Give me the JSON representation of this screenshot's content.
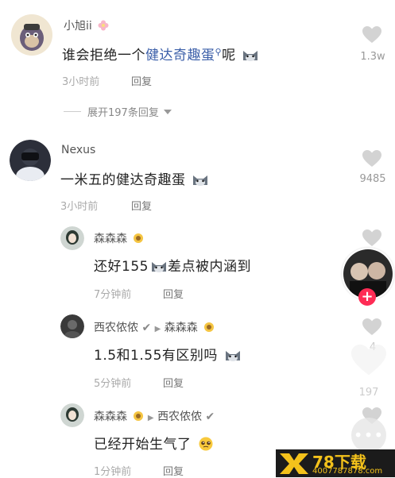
{
  "comments": [
    {
      "user": "小旭ii",
      "text_before": "谁会拒绝一个",
      "text_link": "健达奇趣蛋",
      "text_after": "呢",
      "time": "3小时前",
      "reply_label": "回复",
      "likes": "1.3w",
      "expand_label": "展开197条回复"
    },
    {
      "user": "Nexus",
      "text": "一米五的健达奇趣蛋",
      "time": "3小时前",
      "reply_label": "回复",
      "likes": "9485"
    }
  ],
  "replies": [
    {
      "user": "森森森",
      "text": "还好155",
      "text_after": "差点被内涵到",
      "time": "7分钟前",
      "reply_label": "回复"
    },
    {
      "user": "西农侬侬",
      "reply_to": "森森森",
      "text": "1.5和1.55有区别吗",
      "time": "5分钟前",
      "reply_label": "回复",
      "likes": "4"
    },
    {
      "user": "森森森",
      "reply_to": "西农侬侬",
      "text": "已经开始生气了",
      "time": "1分钟前",
      "reply_label": "回复",
      "likes": "197"
    }
  ],
  "watermark": {
    "brand": "78下载",
    "url": "4007787878.com"
  },
  "colors": {
    "accent": "#fe2c55",
    "link": "#3a5ea8"
  }
}
